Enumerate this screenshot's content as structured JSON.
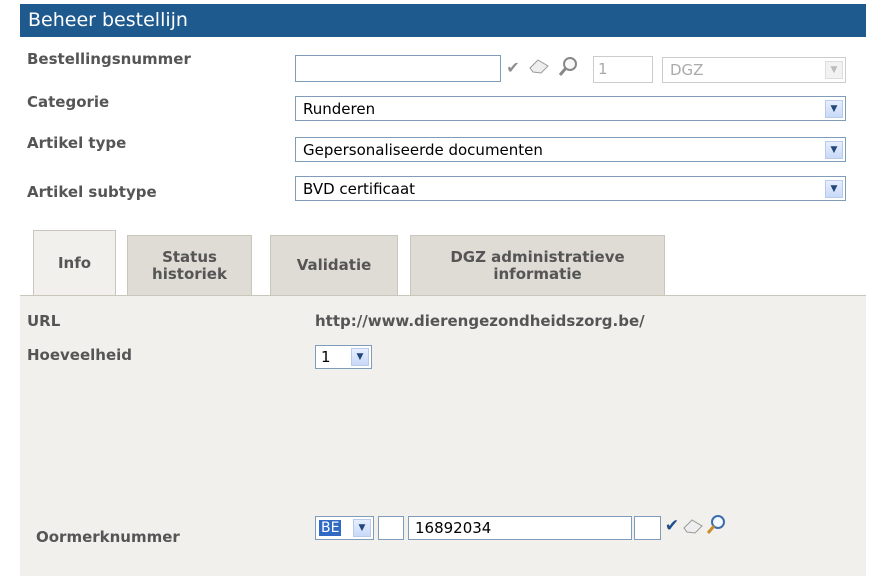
{
  "title": "Beheer bestellijn",
  "form": {
    "bestellingsnummer": {
      "label": "Bestellingsnummer",
      "value": "",
      "count": "1",
      "select": "DGZ"
    },
    "categorie": {
      "label": "Categorie",
      "value": "Runderen"
    },
    "artikel_type": {
      "label": "Artikel type",
      "value": "Gepersonaliseerde documenten"
    },
    "artikel_subtype": {
      "label": "Artikel subtype",
      "value": "BVD certificaat"
    }
  },
  "tabs": [
    {
      "label": "Info",
      "active": true
    },
    {
      "label": "Status historiek",
      "active": false
    },
    {
      "label": "Validatie",
      "active": false
    },
    {
      "label": "DGZ administratieve informatie",
      "active": false
    }
  ],
  "info": {
    "url_label": "URL",
    "url_value": "http://www.dierengezondheidszorg.be/",
    "hoeveelheid_label": "Hoeveelheid",
    "hoeveelheid_value": "1",
    "oormerk_label": "Oormerknummer",
    "oormerk_country": "BE",
    "oormerk_number": "16892034",
    "oormerk_extra": ""
  },
  "icons": [
    "check-icon",
    "eraser-icon",
    "magnifier-icon",
    "chevron-down-icon"
  ]
}
